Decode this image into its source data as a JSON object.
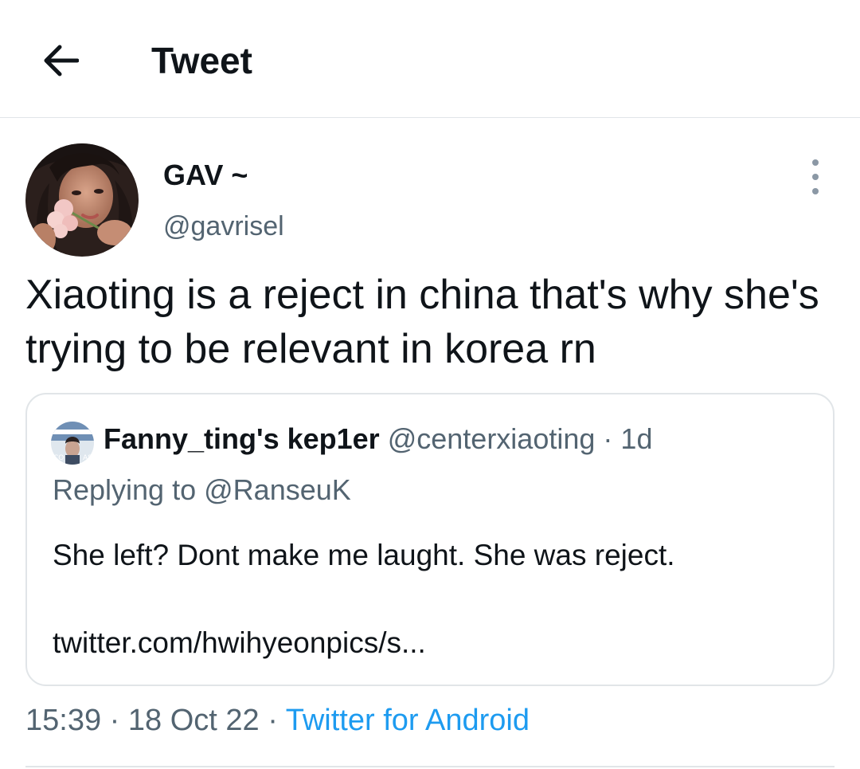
{
  "header": {
    "title": "Tweet"
  },
  "author": {
    "display_name": "GAV ~",
    "handle": "@gavrisel"
  },
  "tweet": {
    "text": "Xiaoting is a reject in china that's why she's trying to be relevant in korea rn"
  },
  "quote": {
    "display_name": "Fanny_ting's kep1er",
    "handle": "@centerxiaoting",
    "separator": "·",
    "age": "1d",
    "replying_prefix": "Replying to",
    "replying_to": "@RanseuK",
    "text": "She left? Dont make me laught. She was reject.",
    "link": "twitter.com/hwihyeonpics/s..."
  },
  "meta": {
    "time": "15:39",
    "separator": "·",
    "date": "18 Oct 22",
    "source": "Twitter for Android"
  },
  "icons": {
    "back": "back-arrow-icon",
    "more": "more-vertical-icon"
  },
  "colors": {
    "text_primary": "#0f1419",
    "text_secondary": "#536471",
    "link": "#1d9bf0",
    "border": "#e1e5e8"
  }
}
